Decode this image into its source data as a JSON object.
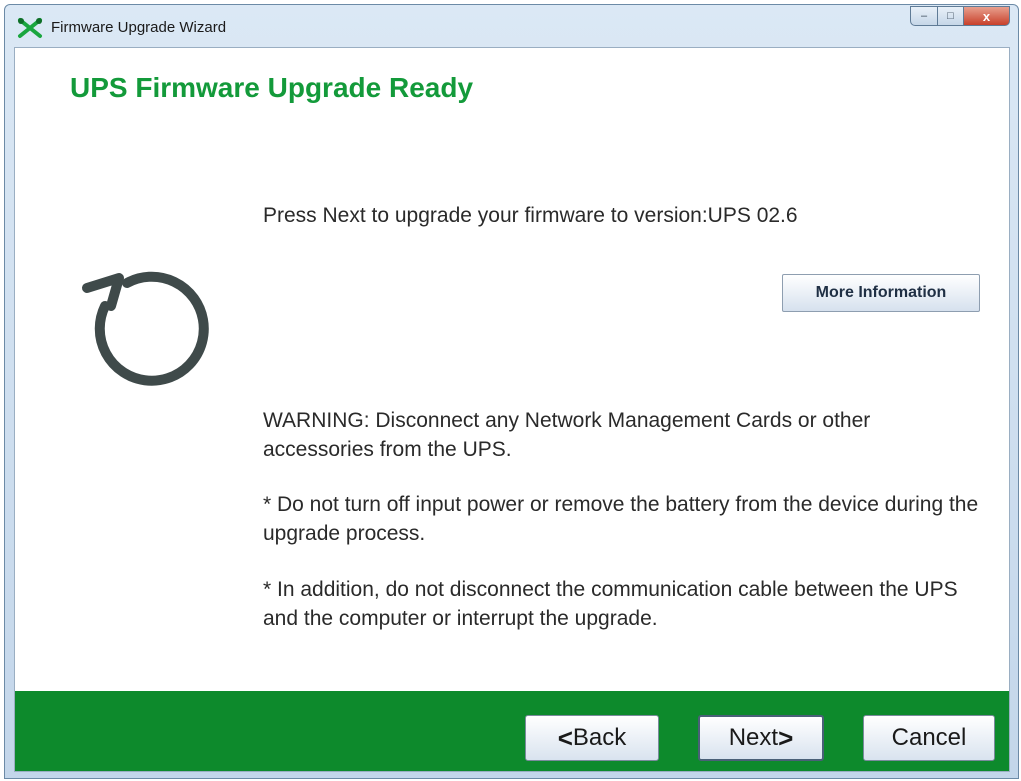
{
  "window": {
    "title": "Firmware Upgrade Wizard",
    "controls": {
      "minimize": "–",
      "maximize": "□",
      "close": "x"
    }
  },
  "page": {
    "title": "UPS Firmware Upgrade Ready",
    "message": "Press Next to upgrade your firmware to version:UPS 02.6",
    "more_info_label": "More Information",
    "warning": "WARNING: Disconnect any Network Management Cards or other accessories from the UPS.",
    "note1": "* Do not turn off input power or remove the battery from the device during the upgrade process.",
    "note2": "* In addition, do not disconnect the communication cable between the UPS and the computer or interrupt the upgrade."
  },
  "footer": {
    "back_label": "Back",
    "next_label": "Next",
    "cancel_label": "Cancel",
    "back_arrow": "<",
    "next_arrow": ">"
  },
  "colors": {
    "accent": "#139a3a",
    "footer": "#0d8a2c"
  },
  "icons": {
    "app": "wrench-cross-icon",
    "upgrade": "refresh-circle-icon"
  }
}
